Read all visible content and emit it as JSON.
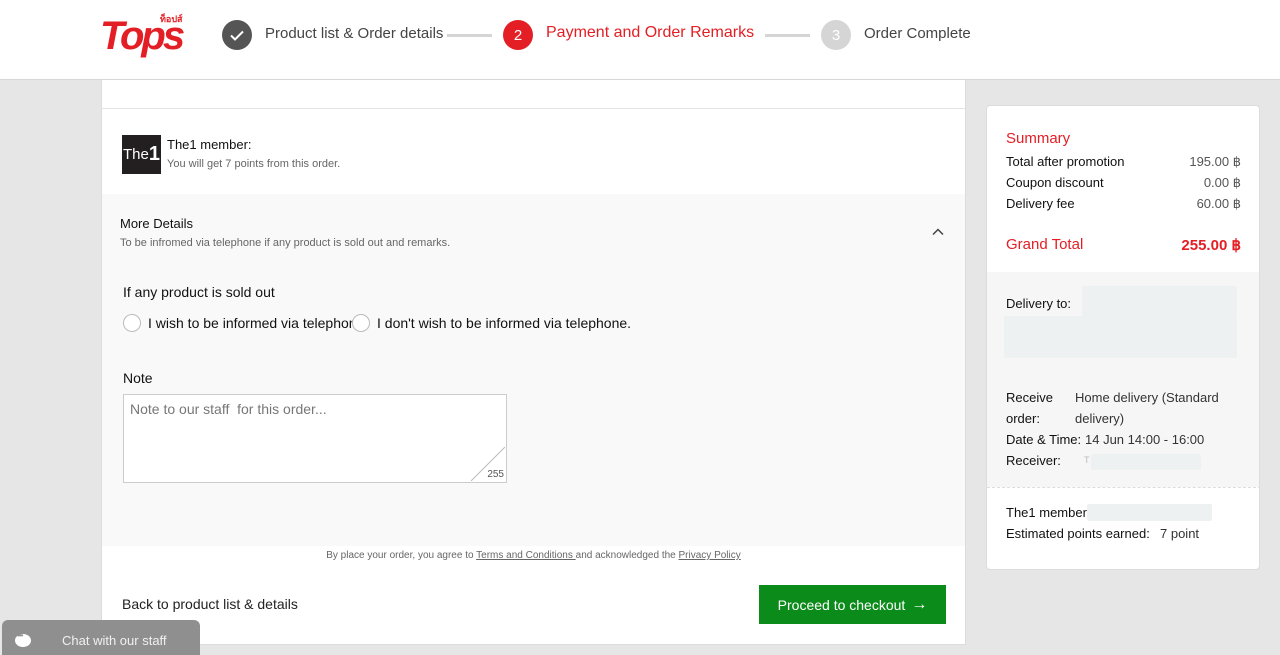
{
  "logo": {
    "word": "Tops",
    "thai": "ท็อปส์"
  },
  "steps": [
    {
      "number": "",
      "label": "Product list & Order details",
      "state": "done",
      "icon": "check-icon"
    },
    {
      "number": "2",
      "label": "Payment and Order Remarks",
      "state": "active"
    },
    {
      "number": "3",
      "label": "Order Complete",
      "state": "pending"
    }
  ],
  "colors": {
    "brand_red": "#e31e24",
    "checkout_green": "#0b8b1a",
    "done_grey": "#555555",
    "pending_grey": "#d5d5d5"
  },
  "member": {
    "logo_text": "The",
    "logo_num": "1",
    "title": "The1 member:",
    "subtitle": "You will get 7 points from this order."
  },
  "more_details": {
    "title": "More Details",
    "subtitle": "To be infromed via telephone if any product is sold out and remarks.",
    "question": "If any product is sold out",
    "options": [
      "I wish to be informed via telephone.",
      "I don't wish to be informed via telephone."
    ],
    "note_label": "Note",
    "note_placeholder": "Note to our staff  for this order...",
    "note_counter": "255"
  },
  "agreement": {
    "prefix": "By place your order, you agree to ",
    "terms": "Terms and Conditions ",
    "middle": "and acknowledged the ",
    "privacy": "Privacy Policy"
  },
  "back_label": "Back to product list & details",
  "checkout_label": "Proceed to checkout",
  "summary": {
    "title": "Summary",
    "rows": [
      {
        "label": "Total after promotion",
        "value": "195.00 ฿"
      },
      {
        "label": "Coupon discount",
        "value": "0.00 ฿"
      },
      {
        "label": "Delivery fee",
        "value": "60.00 ฿"
      }
    ],
    "grand_label": "Grand Total",
    "grand_value": "255.00 ฿",
    "delivery_to": "Delivery to:",
    "receive_label_1": "Receive",
    "receive_label_2": "order:",
    "receive_value_1": "Home delivery (Standard",
    "receive_value_2": "delivery)",
    "datetime_label": "Date & Time:",
    "datetime_value": "14 Jun 14:00 - 16:00",
    "receiver_label": "Receiver:",
    "receiver_value": "T",
    "member_label": "The1 member:",
    "points_label": "Estimated points earned:",
    "points_value": "7 point"
  },
  "chat_label": "Chat with our staff"
}
